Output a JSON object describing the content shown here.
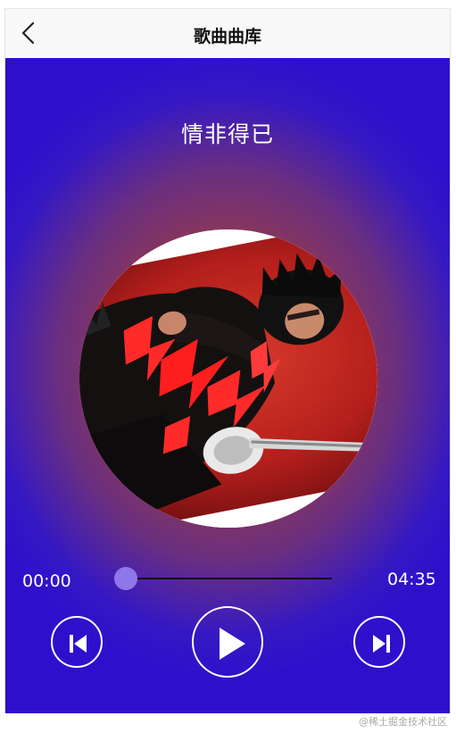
{
  "header": {
    "title": "歌曲曲库",
    "back_icon": "chevron-left-icon"
  },
  "player": {
    "song_title": "情非得已",
    "album_art": "album-cover-guitarist",
    "time_current": "00:00",
    "time_total": "04:35",
    "progress_fraction": 0.0,
    "controls": {
      "prev_icon": "skip-previous-icon",
      "play_icon": "play-icon",
      "next_icon": "skip-next-icon"
    },
    "colors": {
      "gradient_edge": "#2e10cc",
      "gradient_center": "#b2452a",
      "accent": "#8e77e8"
    }
  },
  "watermark": "@稀土掘金技术社区"
}
